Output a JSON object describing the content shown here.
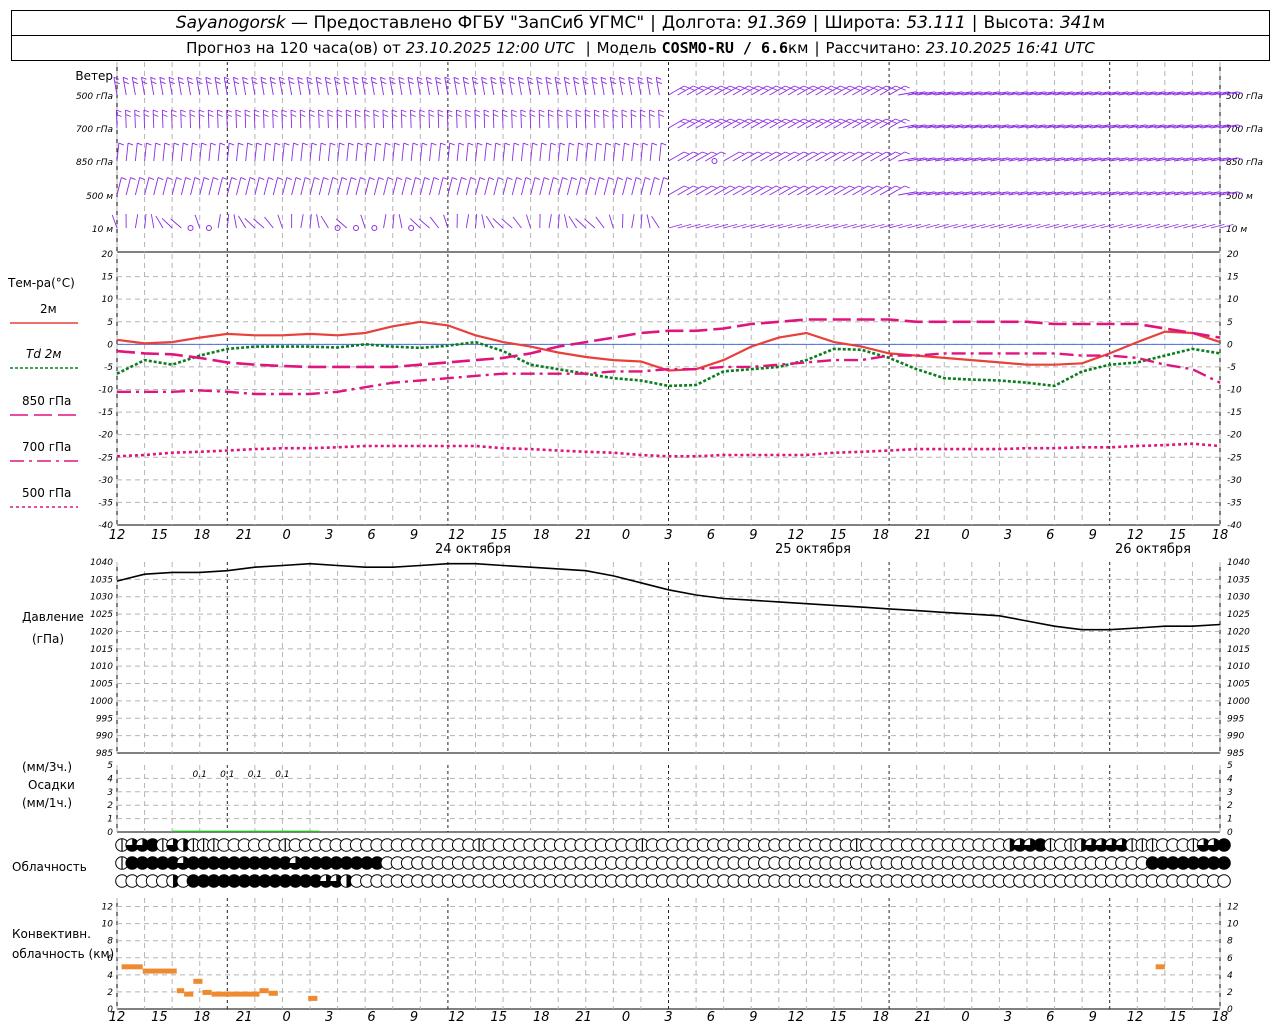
{
  "header": {
    "station": "Sayanogorsk",
    "dash": "—",
    "provider": "Предоставлено ФГБУ \"ЗапСиб УГМС\"",
    "lon_label": "Долгота:",
    "lon_value": "91.369",
    "lat_label": "Широта:",
    "lat_value": "53.111",
    "alt_label": "Высота:",
    "alt_value": "341",
    "alt_unit": "м",
    "forecast_label": "Прогноз на 120 часа(ов) от",
    "forecast_start": "23.10.2025 12:00 UTC",
    "model_label": "Модель",
    "model_name": "COSMO-RU / 6.6",
    "model_unit": "км",
    "calc_label": "Рассчитано:",
    "calc_time": "23.10.2025 16:41 UTC"
  },
  "colors": {
    "wind": "#8b2be2",
    "t2m": "#e8403a",
    "td2m": "#0a7d1e",
    "t_upper": "#e0147d",
    "precip": "#22bb22",
    "convective": "#f08a30",
    "pressure": "#000000",
    "zero_line": "#4a6ee0"
  },
  "chart_data": [
    {
      "type": "wind_barbs",
      "title": "Ветер",
      "levels": [
        "500 гПа",
        "700 гПа",
        "850 гПа",
        "500 м",
        "10 м"
      ],
      "calm_circles_10m": [
        8,
        10,
        24,
        26,
        28,
        32,
        121,
        126,
        142,
        145
      ],
      "calm_circles_850": [
        65
      ]
    },
    {
      "type": "line",
      "title": "Тем-ра(°C)",
      "ylim": [
        -40,
        20
      ],
      "yticks": [
        20,
        15,
        10,
        5,
        0,
        -5,
        -10,
        -15,
        -20,
        -25,
        -30,
        -35,
        -40
      ],
      "legend": [
        "2м",
        "Td 2м",
        "850 гПа",
        "700 гПа",
        "500 гПа"
      ],
      "x_hours": [
        0,
        3,
        6,
        9,
        12,
        15,
        18,
        21,
        24,
        27,
        30,
        33,
        36,
        39,
        42,
        45,
        48,
        51,
        54,
        57,
        60,
        63,
        66,
        69,
        72,
        75,
        78,
        81,
        84,
        87,
        90,
        93,
        96,
        99,
        102,
        105,
        108,
        111,
        114,
        117,
        120
      ],
      "series": [
        {
          "name": "2м",
          "values": [
            1.0,
            0.2,
            0.5,
            1.5,
            2.3,
            2.0,
            2.0,
            2.3,
            2.0,
            2.5,
            4.0,
            5.0,
            4.2,
            2.0,
            0.5,
            -0.5,
            -1.8,
            -2.8,
            -3.5,
            -3.8,
            -5.8,
            -5.5,
            -3.5,
            -0.5,
            1.5,
            2.5,
            0.5,
            -0.5,
            -2.0,
            -2.5,
            -3.0,
            -3.5,
            -4.0,
            -4.5,
            -4.5,
            -4.2,
            -2.0,
            0.5,
            2.8,
            2.5,
            0.5
          ]
        },
        {
          "name": "Td 2м",
          "values": [
            -6.5,
            -3.5,
            -4.5,
            -2.5,
            -1.0,
            -0.5,
            -0.5,
            -0.5,
            -0.7,
            0.0,
            -0.5,
            -0.8,
            -0.3,
            0.5,
            -1.5,
            -4.5,
            -5.5,
            -6.5,
            -7.5,
            -8.0,
            -9.2,
            -9.0,
            -6.0,
            -5.5,
            -5.0,
            -3.5,
            -1.0,
            -1.2,
            -3.0,
            -5.5,
            -7.5,
            -7.8,
            -8.0,
            -8.5,
            -9.2,
            -6.0,
            -4.5,
            -4.0,
            -2.5,
            -1.0,
            -2.0
          ]
        },
        {
          "name": "850 гПа",
          "values": [
            -1.5,
            -2.0,
            -2.2,
            -3.0,
            -4.0,
            -4.5,
            -4.8,
            -5.0,
            -5.0,
            -5.0,
            -5.0,
            -4.5,
            -4.0,
            -3.5,
            -3.0,
            -2.0,
            -0.5,
            0.5,
            1.5,
            2.5,
            3.0,
            3.0,
            3.5,
            4.5,
            5.0,
            5.5,
            5.5,
            5.5,
            5.5,
            5.0,
            5.0,
            5.0,
            5.0,
            5.0,
            4.5,
            4.5,
            4.5,
            4.5,
            3.5,
            2.5,
            1.5
          ]
        },
        {
          "name": "700 гПа",
          "values": [
            -10.5,
            -10.5,
            -10.5,
            -10.2,
            -10.5,
            -11.0,
            -11.0,
            -11.0,
            -10.5,
            -9.5,
            -8.5,
            -8.0,
            -7.5,
            -7.0,
            -6.5,
            -6.5,
            -6.5,
            -6.5,
            -6.0,
            -6.0,
            -5.5,
            -5.5,
            -5.0,
            -5.0,
            -4.5,
            -4.0,
            -3.5,
            -3.5,
            -2.5,
            -2.5,
            -2.0,
            -2.0,
            -2.0,
            -2.0,
            -2.0,
            -2.5,
            -2.5,
            -3.0,
            -4.5,
            -5.5,
            -8.5
          ]
        },
        {
          "name": "500 гПа",
          "values": [
            -24.8,
            -24.5,
            -24.0,
            -23.8,
            -23.5,
            -23.2,
            -23.0,
            -23.0,
            -22.8,
            -22.5,
            -22.5,
            -22.5,
            -22.5,
            -22.5,
            -23.0,
            -23.2,
            -23.5,
            -23.8,
            -24.0,
            -24.5,
            -24.8,
            -24.8,
            -24.5,
            -24.5,
            -24.5,
            -24.5,
            -24.0,
            -23.8,
            -23.5,
            -23.2,
            -23.2,
            -23.2,
            -23.2,
            -23.0,
            -23.0,
            -22.8,
            -22.8,
            -22.5,
            -22.3,
            -22.0,
            -22.5
          ]
        }
      ]
    },
    {
      "type": "line",
      "title": "Давление",
      "ylabel": "(гПа)",
      "ylim": [
        985,
        1040
      ],
      "yticks": [
        1040,
        1035,
        1030,
        1025,
        1020,
        1015,
        1010,
        1005,
        1000,
        995,
        990,
        985
      ],
      "x_hours": [
        0,
        3,
        6,
        9,
        12,
        15,
        18,
        21,
        24,
        27,
        30,
        33,
        36,
        39,
        42,
        45,
        48,
        51,
        54,
        57,
        60,
        63,
        66,
        69,
        72,
        75,
        78,
        81,
        84,
        87,
        90,
        93,
        96,
        99,
        102,
        105,
        108,
        111,
        114,
        117,
        120
      ],
      "series": [
        {
          "name": "Давление",
          "values": [
            1034.5,
            1036.5,
            1037.0,
            1037.0,
            1037.5,
            1038.5,
            1039.0,
            1039.5,
            1039.0,
            1038.5,
            1038.5,
            1039.0,
            1039.5,
            1039.5,
            1039.0,
            1038.5,
            1038.0,
            1037.5,
            1036.0,
            1034.0,
            1032.0,
            1030.5,
            1029.5,
            1029.0,
            1028.5,
            1028.0,
            1027.5,
            1027.0,
            1026.5,
            1026.0,
            1025.5,
            1025.0,
            1024.5,
            1023.0,
            1021.5,
            1020.5,
            1020.5,
            1021.0,
            1021.5,
            1021.5,
            1022.0
          ]
        }
      ]
    },
    {
      "type": "bar",
      "title": "Осадки",
      "ylabel_top": "(мм/3ч.)",
      "ylabel_bottom": "(мм/1ч.)",
      "ylim": [
        0,
        5
      ],
      "yticks": [
        5,
        4,
        3,
        2,
        1,
        0
      ],
      "annotations": [
        {
          "hour": 9,
          "text": "0.1"
        },
        {
          "hour": 12,
          "text": "0.1"
        },
        {
          "hour": 15,
          "text": "0.1"
        },
        {
          "hour": 18,
          "text": "0.1"
        }
      ],
      "precip_hours": [
        6,
        7,
        8,
        9,
        10,
        11,
        12,
        13,
        14,
        15,
        16,
        17,
        18,
        19,
        20,
        21
      ],
      "precip_values": [
        0.1,
        0.1,
        0.1,
        0.1,
        0.1,
        0.1,
        0.1,
        0.1,
        0.1,
        0.1,
        0.1,
        0.1,
        0.1,
        0.1,
        0.1,
        0.1
      ]
    },
    {
      "type": "table",
      "title": "Облачность",
      "levels": [
        "high",
        "middle",
        "low"
      ],
      "rows": [
        "1334132111000000100000000000000000010000000000000001000000000000000000001000000000000002334101233331110001334",
        "1444443444444444434444444400000000000000000000000000000000000000000000000000000000000000000000000000044444444",
        "0000020444444444444433200000000000000000000000000000000000000000000000000000000000000000000000000000000000000"
      ]
    },
    {
      "type": "bar",
      "title": "Конвективн.",
      "ylabel": "облачность (км)",
      "ylim": [
        0,
        13
      ],
      "yticks": [
        12,
        10,
        8,
        6,
        4,
        2,
        0
      ],
      "segments": [
        {
          "h0": 0.5,
          "h1": 2.8,
          "km": 5.0
        },
        {
          "h0": 2.8,
          "h1": 6.5,
          "km": 4.5
        },
        {
          "h0": 6.5,
          "h1": 7.3,
          "km": 2.2
        },
        {
          "h0": 7.3,
          "h1": 8.3,
          "km": 1.8
        },
        {
          "h0": 8.3,
          "h1": 9.3,
          "km": 3.3
        },
        {
          "h0": 9.3,
          "h1": 10.3,
          "km": 2.0
        },
        {
          "h0": 10.3,
          "h1": 15.5,
          "km": 1.8
        },
        {
          "h0": 15.5,
          "h1": 16.5,
          "km": 2.2
        },
        {
          "h0": 16.5,
          "h1": 17.5,
          "km": 1.9
        },
        {
          "h0": 20.8,
          "h1": 21.8,
          "km": 1.3
        },
        {
          "h0": 113.0,
          "h1": 114.0,
          "km": 5.0
        }
      ]
    }
  ],
  "x_axis": {
    "hour_labels": [
      "12",
      "15",
      "18",
      "21",
      "0",
      "3",
      "6",
      "9",
      "12",
      "15",
      "18",
      "21",
      "0",
      "3",
      "6",
      "9",
      "12",
      "15",
      "18",
      "21",
      "0",
      "3",
      "6",
      "9",
      "12",
      "15",
      "18"
    ],
    "date_labels": [
      {
        "hour": 24,
        "text": "24 октября"
      },
      {
        "hour": 48,
        "text": "25 октября"
      },
      {
        "hour": 72,
        "text": "26 октября"
      }
    ]
  }
}
